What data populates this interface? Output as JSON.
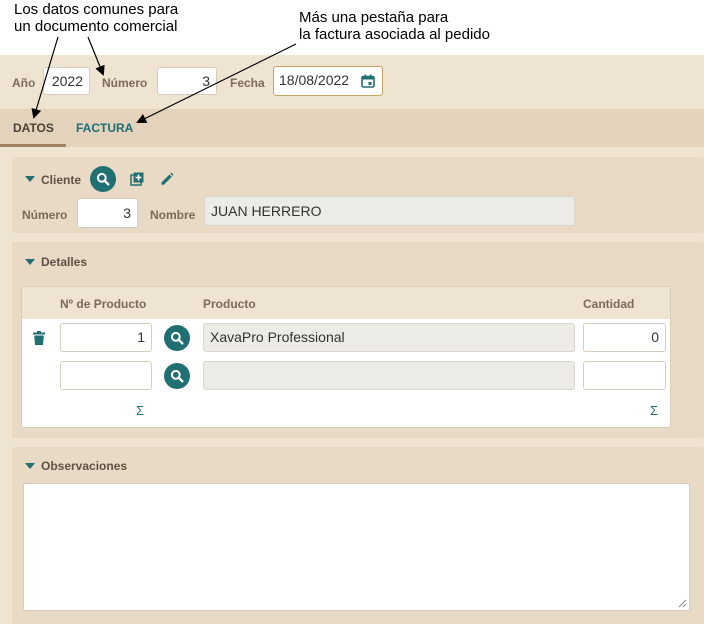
{
  "annotations": {
    "left_line1": "Los datos comunes para",
    "left_line2": "un documento comercial",
    "right_line1": "Más una pestaña para",
    "right_line2": "la factura asociada al pedido"
  },
  "header": {
    "anio_label": "Año",
    "anio_value": "2022",
    "numero_label": "Número",
    "numero_value": "3",
    "fecha_label": "Fecha",
    "fecha_value": "18/08/2022"
  },
  "tabs": [
    {
      "label": "DATOS",
      "active": true
    },
    {
      "label": "FACTURA",
      "active": false
    }
  ],
  "cliente": {
    "title": "Cliente",
    "numero_label": "Número",
    "numero_value": "3",
    "nombre_label": "Nombre",
    "nombre_value": "JUAN HERRERO"
  },
  "detalles": {
    "title": "Detalles",
    "columns": [
      "Nº de Producto",
      "Producto",
      "Cantidad"
    ],
    "rows": [
      {
        "numero": "1",
        "producto": "XavaPro Professional",
        "cantidad": "0"
      },
      {
        "numero": "",
        "producto": "",
        "cantidad": ""
      }
    ],
    "sum_symbol": "Σ"
  },
  "observaciones": {
    "title": "Observaciones",
    "value": ""
  },
  "colors": {
    "accent": "#1f6f73",
    "background": "#efe3d1",
    "section": "#e8dac5"
  },
  "icons": [
    "search-icon",
    "add-icon",
    "edit-icon",
    "calendar-icon",
    "trash-icon",
    "resize-handle-icon"
  ]
}
